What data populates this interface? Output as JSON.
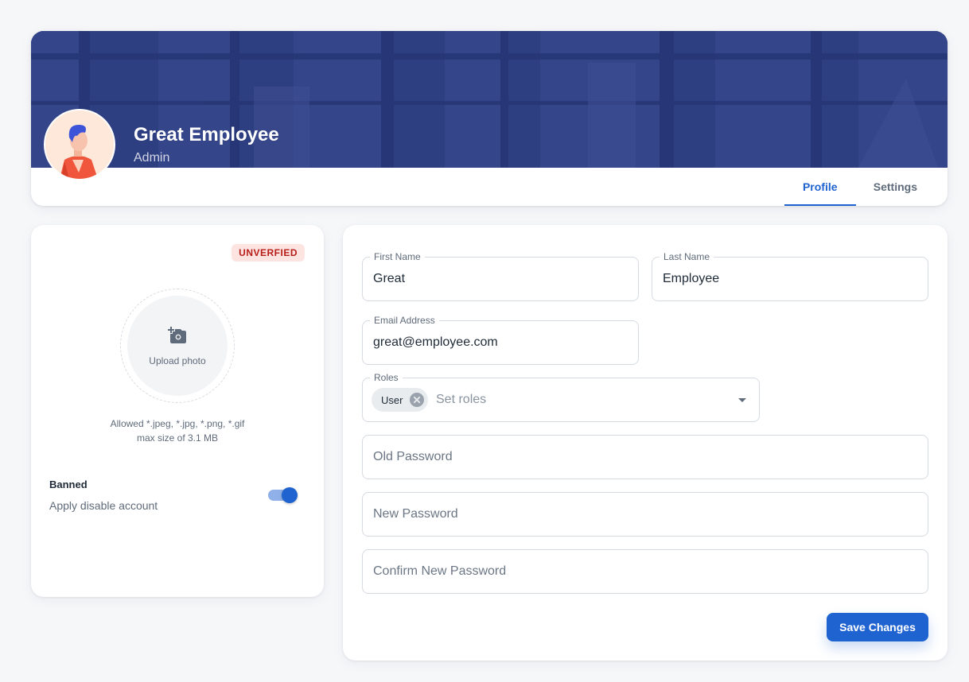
{
  "profile": {
    "name": "Great Employee",
    "role": "Admin"
  },
  "tabs": [
    {
      "label": "Profile",
      "active": true
    },
    {
      "label": "Settings",
      "active": false
    }
  ],
  "left": {
    "status_badge": "UNVERFIED",
    "upload_label": "Upload photo",
    "allowed_line1": "Allowed *.jpeg, *.jpg, *.png, *.gif",
    "allowed_line2": "max size of 3.1 MB",
    "banned_title": "Banned",
    "banned_desc": "Apply disable account",
    "banned_on": true
  },
  "form": {
    "first_name": {
      "label": "First Name",
      "value": "Great"
    },
    "last_name": {
      "label": "Last Name",
      "value": "Employee"
    },
    "email": {
      "label": "Email Address",
      "value": "great@employee.com"
    },
    "roles": {
      "label": "Roles",
      "chip": "User",
      "placeholder": "Set roles"
    },
    "old_password": {
      "placeholder": "Old Password"
    },
    "new_password": {
      "placeholder": "New Password"
    },
    "confirm_password": {
      "placeholder": "Confirm New Password"
    },
    "save_label": "Save Changes"
  },
  "colors": {
    "primary": "#1f63d1",
    "error_bg": "#fde4e1",
    "error_text": "#b71d18",
    "cover": "#303f80"
  },
  "icons": {
    "upload": "add-a-photo-icon",
    "chip_remove": "cancel-circle-icon",
    "dropdown": "caret-down-icon"
  }
}
